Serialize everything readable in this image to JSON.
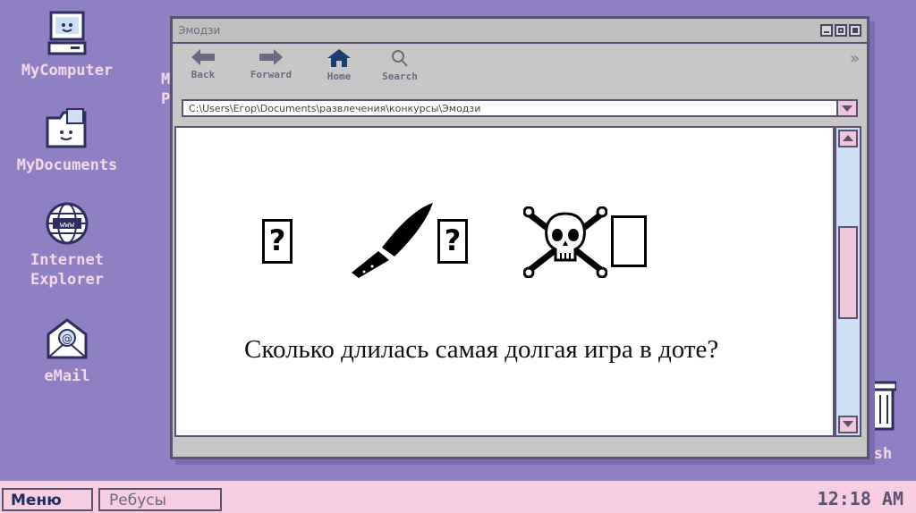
{
  "desktop": {
    "icons": [
      {
        "label": "MyComputer",
        "icon": "computer-icon"
      },
      {
        "label": "MyDocuments",
        "icon": "folder-icon"
      },
      {
        "label": "Internet\nExplorer",
        "icon": "globe-icon"
      },
      {
        "label": "eMail",
        "icon": "mail-icon"
      }
    ],
    "partial_label": "M\nP",
    "trash_label": "Trash"
  },
  "window": {
    "title": "Эмодзи",
    "toolbar": {
      "back": "Back",
      "forward": "Forward",
      "home": "Home",
      "search": "Search"
    },
    "address": "C:\\Users\\Егор\\Documents\\развлечения\\конкурсы\\Эмодзи",
    "emoji_placeholder": "?",
    "question": "Сколько длилась самая долгая игра в доте?"
  },
  "taskbar": {
    "start_label": "Меню",
    "task_label": "Ребусы",
    "clock": "12:18 AM"
  },
  "colors": {
    "desktop": "#8f80c4",
    "taskbar": "#f6cde1",
    "accent_pink": "#f0c6da",
    "scroll_track": "#cfe0f6",
    "border": "#5a5270"
  }
}
